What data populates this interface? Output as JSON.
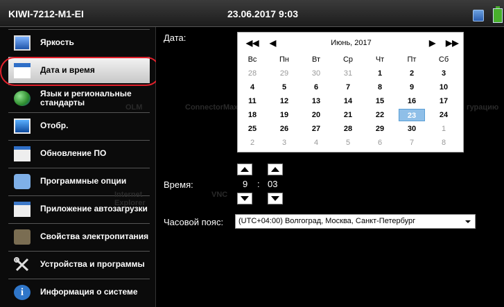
{
  "titlebar": {
    "device": "KIWI-7212-M1-EI",
    "datetime": "23.06.2017 9:03"
  },
  "menu": [
    {
      "id": "brightness",
      "label": "Яркость",
      "icon": "monitor-icon"
    },
    {
      "id": "datetime",
      "label": "Дата и время",
      "icon": "calendar-icon",
      "selected": true
    },
    {
      "id": "language",
      "label": "Язык и региональные стандарты",
      "icon": "globe-icon"
    },
    {
      "id": "display",
      "label": "Отобр.",
      "icon": "display-icon"
    },
    {
      "id": "update",
      "label": "Обновление ПО",
      "icon": "download-icon"
    },
    {
      "id": "programs",
      "label": "Программные опции",
      "icon": "puzzle-icon"
    },
    {
      "id": "startup",
      "label": "Приложение автозагрузки",
      "icon": "star-icon"
    },
    {
      "id": "power",
      "label": "Свойства электропитания",
      "icon": "power-icon"
    },
    {
      "id": "devices",
      "label": "Устройства и программы",
      "icon": "tools-icon"
    },
    {
      "id": "info",
      "label": "Информация о системе",
      "icon": "info-icon"
    }
  ],
  "main": {
    "date_label": "Дата:",
    "time_label": "Время:",
    "tz_label": "Часовой пояс:",
    "calendar": {
      "month": "Июнь, 2017",
      "nav": {
        "prev_year": "◀◀",
        "prev_month": "◀",
        "next_month": "▶",
        "next_year": "▶▶"
      },
      "weekdays": [
        "Вс",
        "Пн",
        "Вт",
        "Ср",
        "Чт",
        "Пт",
        "Сб"
      ],
      "weeks": [
        [
          "28",
          "29",
          "30",
          "31",
          "1",
          "2",
          "3"
        ],
        [
          "4",
          "5",
          "6",
          "7",
          "8",
          "9",
          "10"
        ],
        [
          "11",
          "12",
          "13",
          "14",
          "15",
          "16",
          "17"
        ],
        [
          "18",
          "19",
          "20",
          "21",
          "22",
          "23",
          "24"
        ],
        [
          "25",
          "26",
          "27",
          "28",
          "29",
          "30",
          "1"
        ],
        [
          "2",
          "3",
          "4",
          "5",
          "6",
          "7",
          "8"
        ]
      ],
      "selected_day": "23"
    },
    "time": {
      "hours": "9",
      "sep": ":",
      "minutes": "03"
    },
    "timezone": "(UTC+04:00) Волгоград, Москва, Санкт-Петербург"
  },
  "background_ghost_text": [
    "OLM",
    "ConnectorMax",
    "VNC",
    "Internet Explorer",
    "гурацию"
  ],
  "colors": {
    "selection_ring": "#e0202b",
    "selected_day": "#8fbfe8"
  }
}
